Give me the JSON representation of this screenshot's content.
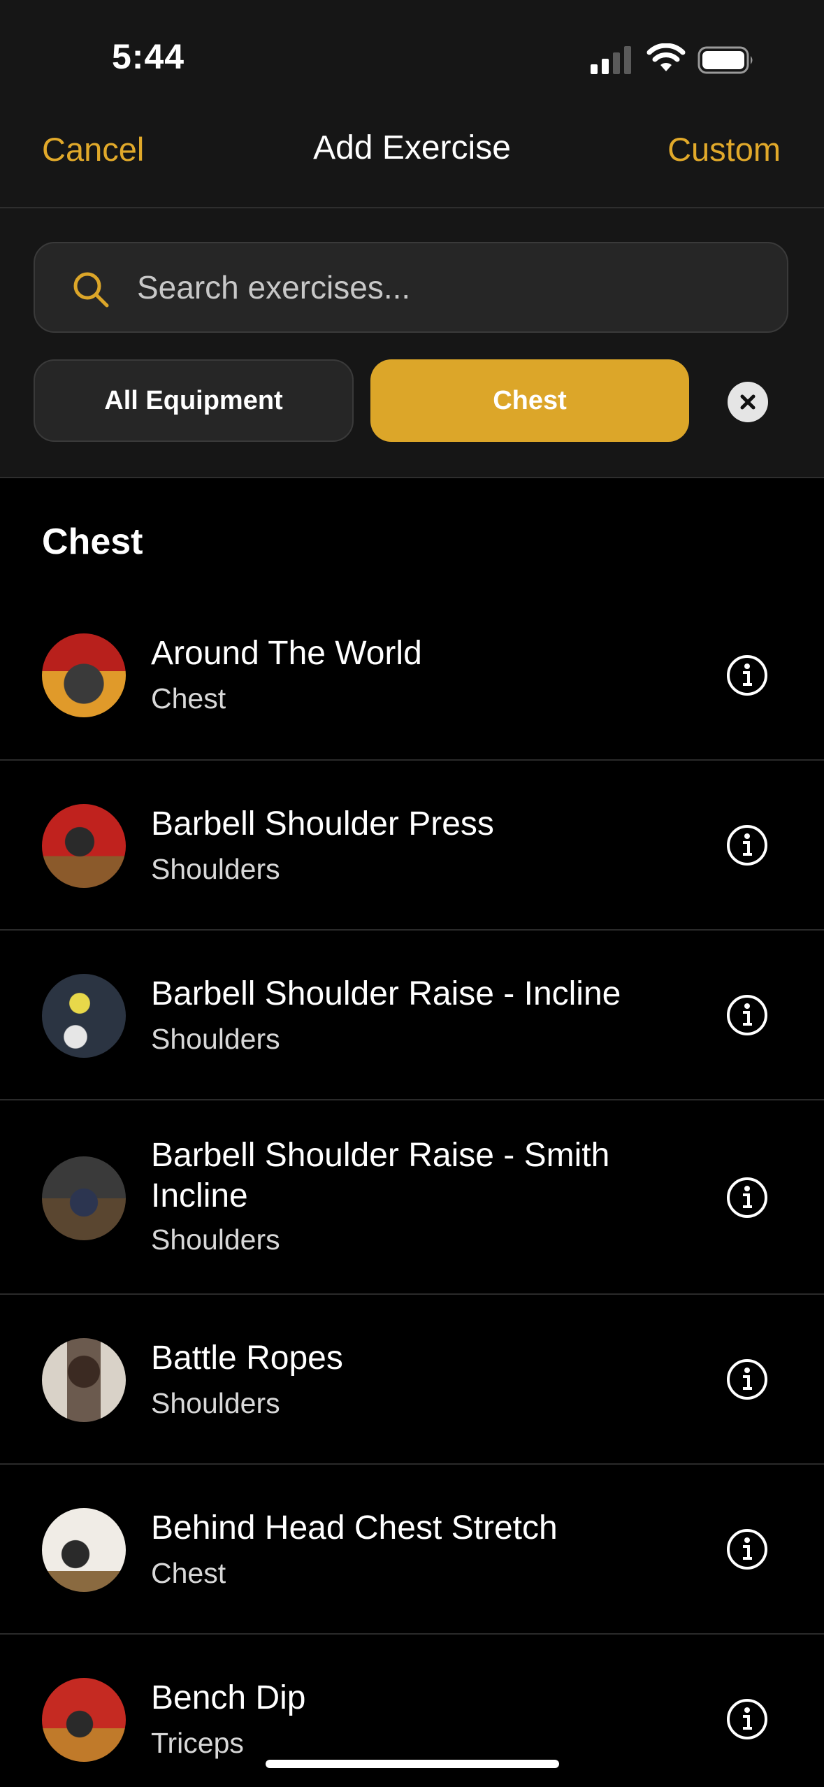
{
  "status_bar": {
    "time": "5:44"
  },
  "nav": {
    "cancel_label": "Cancel",
    "title": "Add Exercise",
    "custom_label": "Custom"
  },
  "search": {
    "placeholder": "Search exercises...",
    "value": ""
  },
  "filters": {
    "equipment_label": "All Equipment",
    "muscle_label": "Chest"
  },
  "section": {
    "title": "Chest"
  },
  "exercises": [
    {
      "name": "Around The World",
      "muscle": "Chest",
      "thumb": "chest-press"
    },
    {
      "name": "Barbell Shoulder Press",
      "muscle": "Shoulders",
      "thumb": "barbell-press"
    },
    {
      "name": "Barbell Shoulder Raise - Incline",
      "muscle": "Shoulders",
      "thumb": "incline-raise"
    },
    {
      "name": "Barbell Shoulder Raise - Smith Incline",
      "muscle": "Shoulders",
      "thumb": "smith-incline"
    },
    {
      "name": "Battle Ropes",
      "muscle": "Shoulders",
      "thumb": "battle-ropes"
    },
    {
      "name": "Behind Head Chest Stretch",
      "muscle": "Chest",
      "thumb": "chest-stretch"
    },
    {
      "name": "Bench Dip",
      "muscle": "Triceps",
      "thumb": "bench-dip"
    }
  ],
  "colors": {
    "accent": "#dca629",
    "background": "#000000",
    "panel": "#161616"
  }
}
